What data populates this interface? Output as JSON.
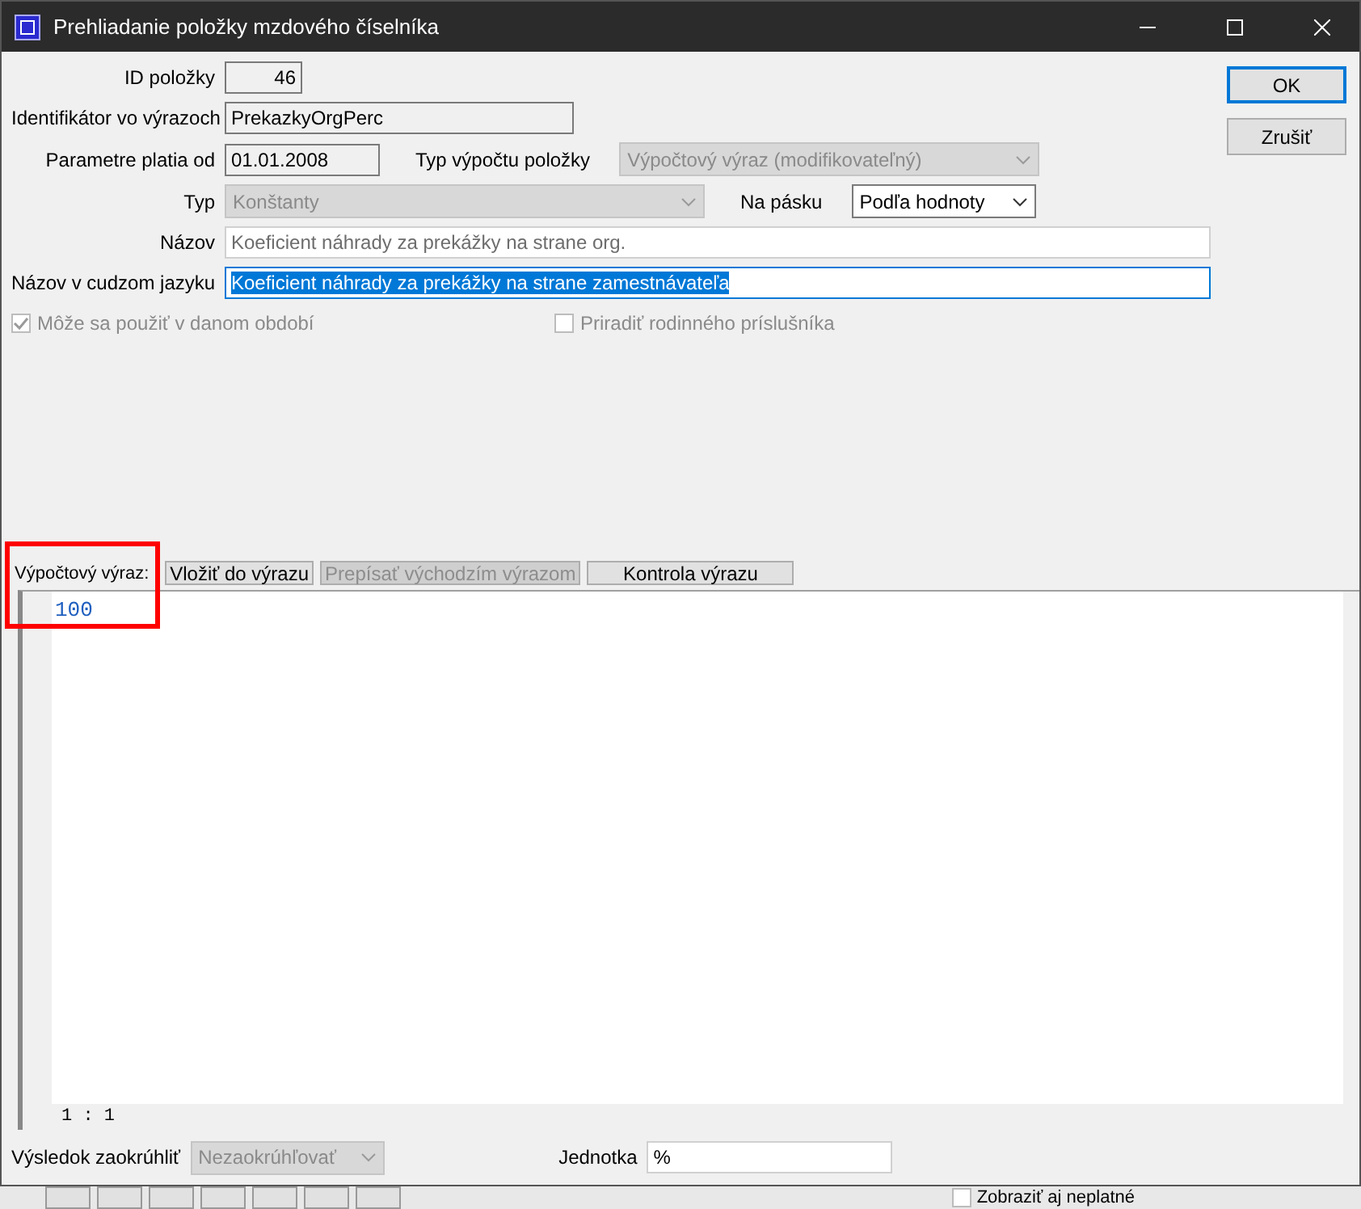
{
  "window": {
    "title": "Prehliadanie položky mzdového číselníka"
  },
  "buttons": [
    {
      "label": "OK",
      "kind": "default"
    },
    {
      "label": "Zrušiť",
      "kind": "normal"
    }
  ],
  "form": {
    "item_id": {
      "label": "ID položky",
      "value": "46"
    },
    "identifier": {
      "label": "Identifikátor vo výrazoch",
      "value": "PrekazkyOrgPerc"
    },
    "valid_from": {
      "label": "Parametre platia od",
      "value": "01.01.2008"
    },
    "calc_type": {
      "label": "Typ výpočtu položky",
      "value": "Výpočtový výraz (modifikovateľný)",
      "disabled": true
    },
    "type": {
      "label": "Typ",
      "value": "Konštanty",
      "disabled": true
    },
    "on_payslip": {
      "label": "Na pásku",
      "value": "Podľa hodnoty",
      "disabled": false
    },
    "name": {
      "label": "Názov",
      "value": "Koeficient náhrady za prekážky na strane org."
    },
    "foreign_name": {
      "label": "Názov v cudzom jazyku",
      "value": "Koeficient náhrady za prekážky na strane zamestnávateľa",
      "selected": true
    }
  },
  "checkboxes": [
    {
      "label": "Môže sa použiť v danom období",
      "checked": true,
      "disabled": true
    },
    {
      "label": "Priradiť rodinného príslušníka",
      "checked": false,
      "disabled": true
    }
  ],
  "expression": {
    "label": "Výpočtový výraz:",
    "buttons": [
      {
        "label": "Vložiť do výrazu",
        "disabled": false
      },
      {
        "label": "Prepísať východzím výrazom",
        "disabled": true
      },
      {
        "label": "Kontrola výrazu",
        "disabled": false
      }
    ],
    "code": "100",
    "cursor": "1 : 1"
  },
  "footer": {
    "rounding": {
      "label": "Výsledok zaokrúhliť",
      "value": "Nezaokrúhľovať",
      "disabled": true
    },
    "unit": {
      "label": "Jednotka",
      "value": "%"
    }
  },
  "background": {
    "checkbox_label": "Zobraziť aj neplatné",
    "checked": false
  }
}
